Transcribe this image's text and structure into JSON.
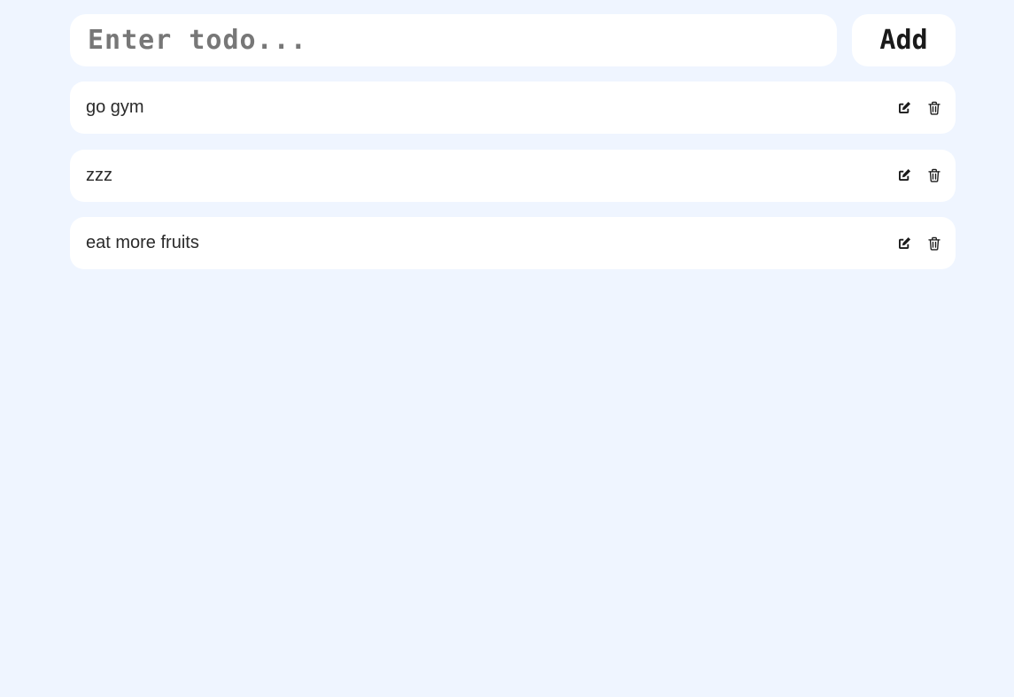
{
  "input": {
    "value": "",
    "placeholder": "Enter todo..."
  },
  "add_button": {
    "label": "Add"
  },
  "todos": [
    {
      "text": "go gym",
      "edit_icon": "edit-icon",
      "delete_icon": "trash-icon"
    },
    {
      "text": "zzz",
      "edit_icon": "edit-icon",
      "delete_icon": "trash-icon"
    },
    {
      "text": "eat more fruits",
      "edit_icon": "edit-icon",
      "delete_icon": "trash-icon"
    }
  ],
  "colors": {
    "background": "#eff5ff",
    "card": "#ffffff",
    "text": "#2a2a2a",
    "placeholder": "#777777",
    "icon": "#1a1a1a"
  }
}
